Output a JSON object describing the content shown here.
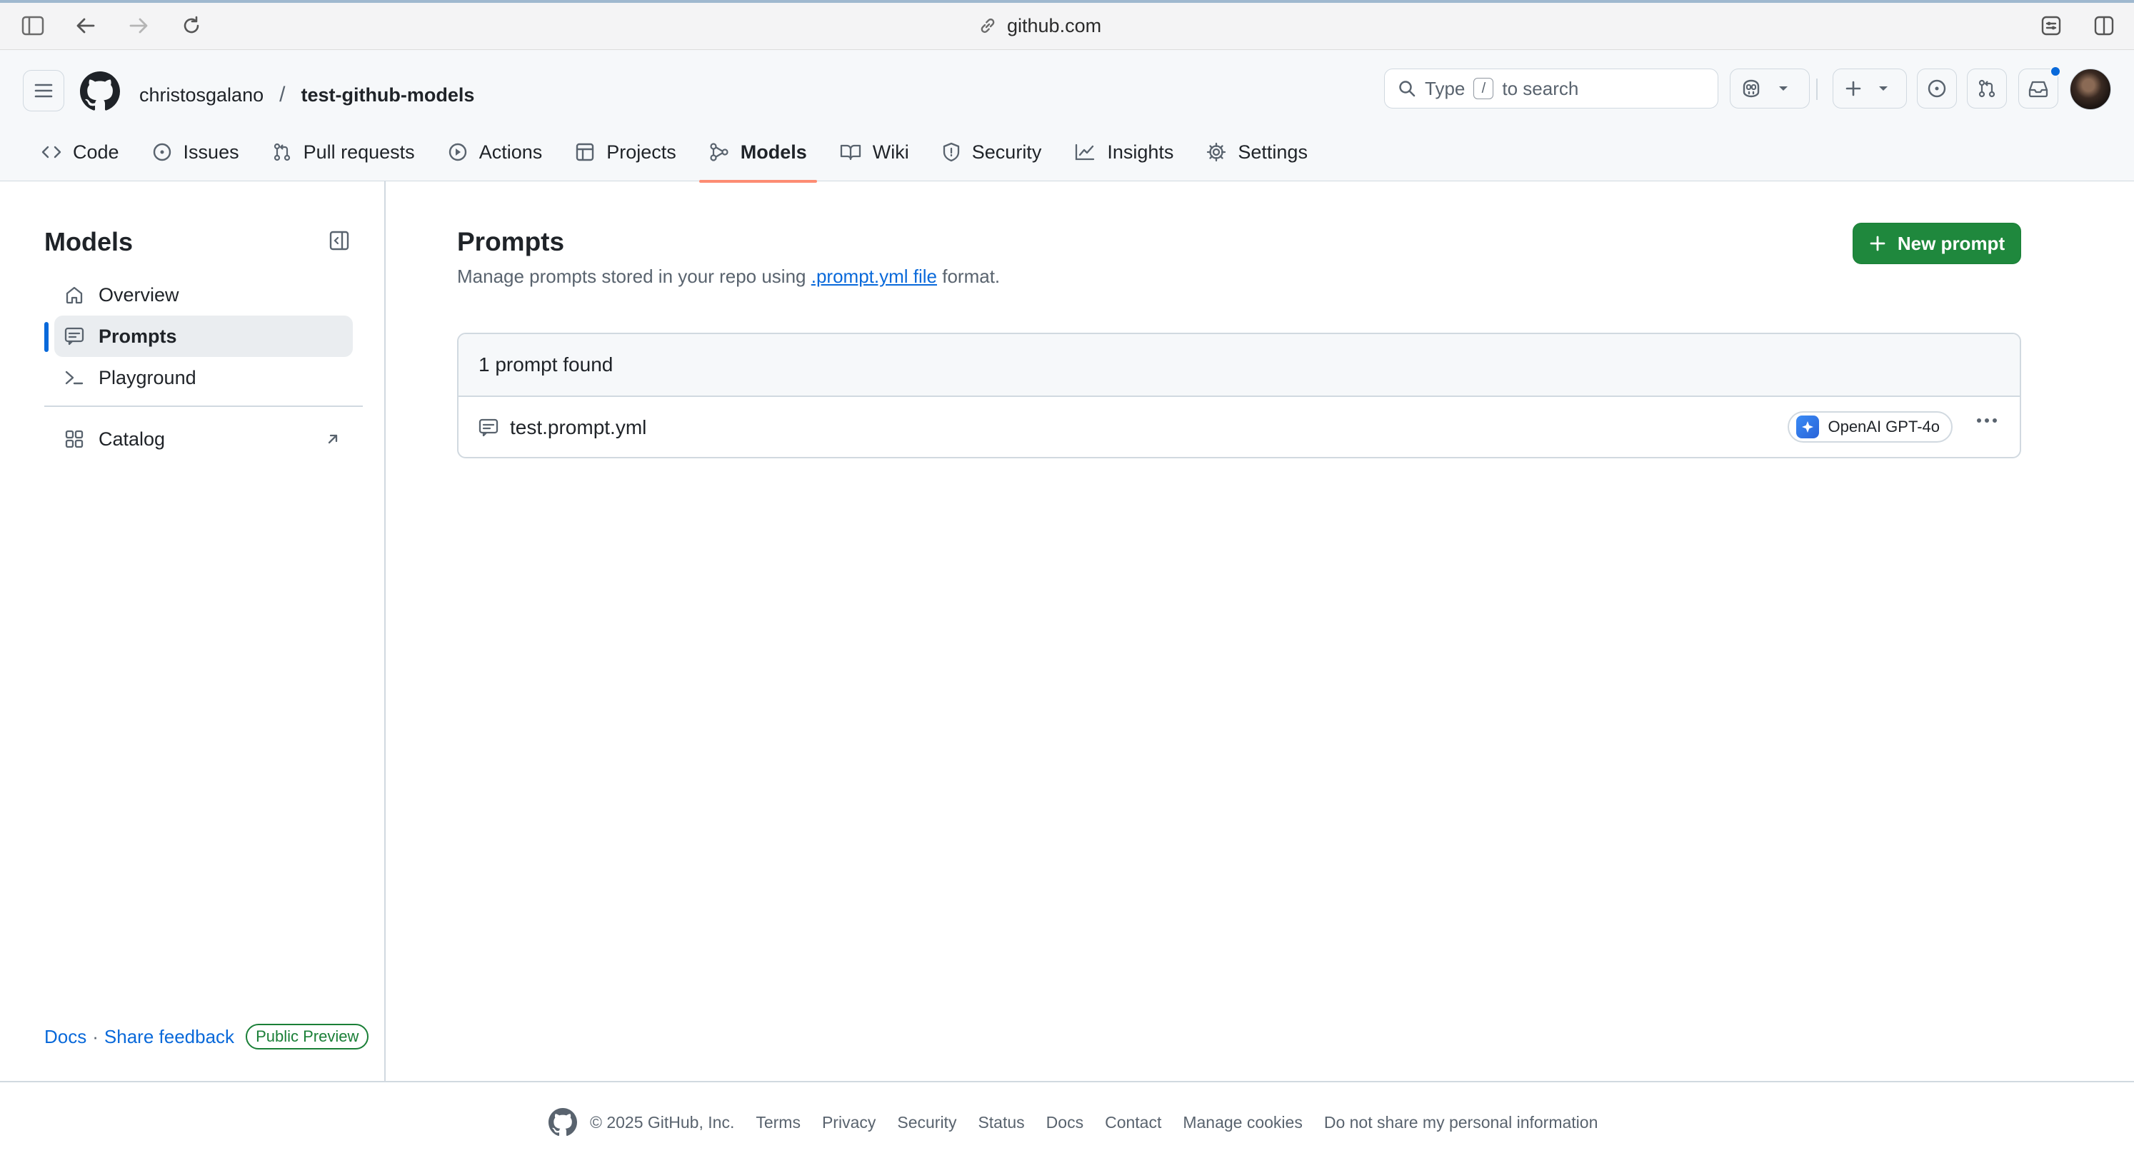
{
  "browser": {
    "address": "github.com"
  },
  "header": {
    "owner": "christosgalano",
    "separator": "/",
    "repo": "test-github-models",
    "search": {
      "prefix": "Type",
      "key": "/",
      "suffix": "to search"
    }
  },
  "tabs": [
    {
      "label": "Code",
      "icon": "code-icon"
    },
    {
      "label": "Issues",
      "icon": "issue-icon"
    },
    {
      "label": "Pull requests",
      "icon": "pull-request-icon"
    },
    {
      "label": "Actions",
      "icon": "play-icon"
    },
    {
      "label": "Projects",
      "icon": "table-icon"
    },
    {
      "label": "Models",
      "icon": "models-icon",
      "active": true
    },
    {
      "label": "Wiki",
      "icon": "book-icon"
    },
    {
      "label": "Security",
      "icon": "shield-icon"
    },
    {
      "label": "Insights",
      "icon": "graph-icon"
    },
    {
      "label": "Settings",
      "icon": "gear-icon"
    }
  ],
  "sidebar": {
    "title": "Models",
    "items": [
      {
        "label": "Overview",
        "icon": "home-icon"
      },
      {
        "label": "Prompts",
        "icon": "comment-icon",
        "active": true
      },
      {
        "label": "Playground",
        "icon": "terminal-icon"
      },
      {
        "label": "Catalog",
        "icon": "apps-icon",
        "external": true
      }
    ],
    "footer": {
      "docs": "Docs",
      "dot": "·",
      "feedback": "Share feedback",
      "badge": "Public Preview"
    }
  },
  "main": {
    "title": "Prompts",
    "description_pre": "Manage prompts stored in your repo using",
    "description_link": ".prompt.yml file",
    "description_post": "format.",
    "new_button": "New prompt",
    "list": {
      "count_label": "1 prompt found",
      "rows": [
        {
          "name": "test.prompt.yml",
          "model": "OpenAI GPT-4o"
        }
      ]
    }
  },
  "footer": {
    "copyright": "© 2025 GitHub, Inc.",
    "links": [
      "Terms",
      "Privacy",
      "Security",
      "Status",
      "Docs",
      "Contact",
      "Manage cookies",
      "Do not share my personal information"
    ]
  },
  "colors": {
    "accent": "#0969da",
    "primary_button": "#1f883d",
    "active_tab_underline": "#fd8c73",
    "badge_green": "#1a7f37"
  }
}
